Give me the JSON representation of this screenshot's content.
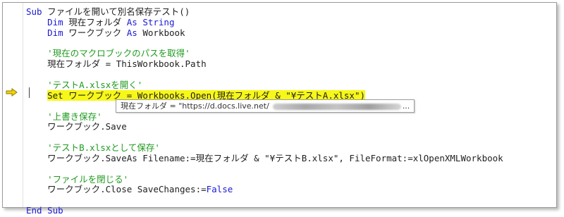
{
  "editor": {
    "colors": {
      "keyword": "#1919d6",
      "comment": "#1e9a1e",
      "highlight": "#f7f718",
      "arrow": "#f5d300"
    },
    "indicator_icon": "execution-arrow-icon",
    "tooltip": {
      "text": "現在フォルダ = \"https://d.docs.live.net/",
      "ellipsis": "..."
    },
    "lines": [
      [
        {
          "t": "Sub",
          "c": "kw"
        },
        {
          "t": " ファイルを開いて別名保存テスト()",
          "c": ""
        }
      ],
      [
        {
          "t": "    ",
          "c": ""
        },
        {
          "t": "Dim",
          "c": "kw"
        },
        {
          "t": " 現在フォルダ ",
          "c": ""
        },
        {
          "t": "As String",
          "c": "kw"
        }
      ],
      [
        {
          "t": "    ",
          "c": ""
        },
        {
          "t": "Dim",
          "c": "kw"
        },
        {
          "t": " ワークブック ",
          "c": ""
        },
        {
          "t": "As",
          "c": "kw"
        },
        {
          "t": " Workbook",
          "c": ""
        }
      ],
      [],
      [
        {
          "t": "    ",
          "c": ""
        },
        {
          "t": "'現在のマクロブックのパスを取得'",
          "c": "cm"
        }
      ],
      [
        {
          "t": "    現在フォルダ = ThisWorkbook.Path",
          "c": ""
        }
      ],
      [],
      [
        {
          "t": "    ",
          "c": ""
        },
        {
          "t": "'テストA.xlsxを開く'",
          "c": "cm"
        }
      ],
      [
        {
          "t": "    ",
          "c": ""
        },
        {
          "t": "Set ワークブック = Workbooks.Open(現在フォルダ & \"¥テストA.xlsx\")",
          "c": "hl"
        }
      ],
      [],
      [
        {
          "t": "    ",
          "c": ""
        },
        {
          "t": "'上書き保存'",
          "c": "cm"
        }
      ],
      [
        {
          "t": "    ワークブック.Save",
          "c": ""
        }
      ],
      [],
      [
        {
          "t": "    ",
          "c": ""
        },
        {
          "t": "'テストB.xlsxとして保存'",
          "c": "cm"
        }
      ],
      [
        {
          "t": "    ワークブック.SaveAs Filename:=現在フォルダ & \"¥テストB.xlsx\", FileFormat:=xlOpenXMLWorkbook",
          "c": ""
        }
      ],
      [],
      [
        {
          "t": "    ",
          "c": ""
        },
        {
          "t": "'ファイルを閉じる'",
          "c": "cm"
        }
      ],
      [
        {
          "t": "    ワークブック.Close SaveChanges:=",
          "c": ""
        },
        {
          "t": "False",
          "c": "kw"
        }
      ],
      [],
      [
        {
          "t": "End Sub",
          "c": "kw"
        }
      ]
    ]
  }
}
